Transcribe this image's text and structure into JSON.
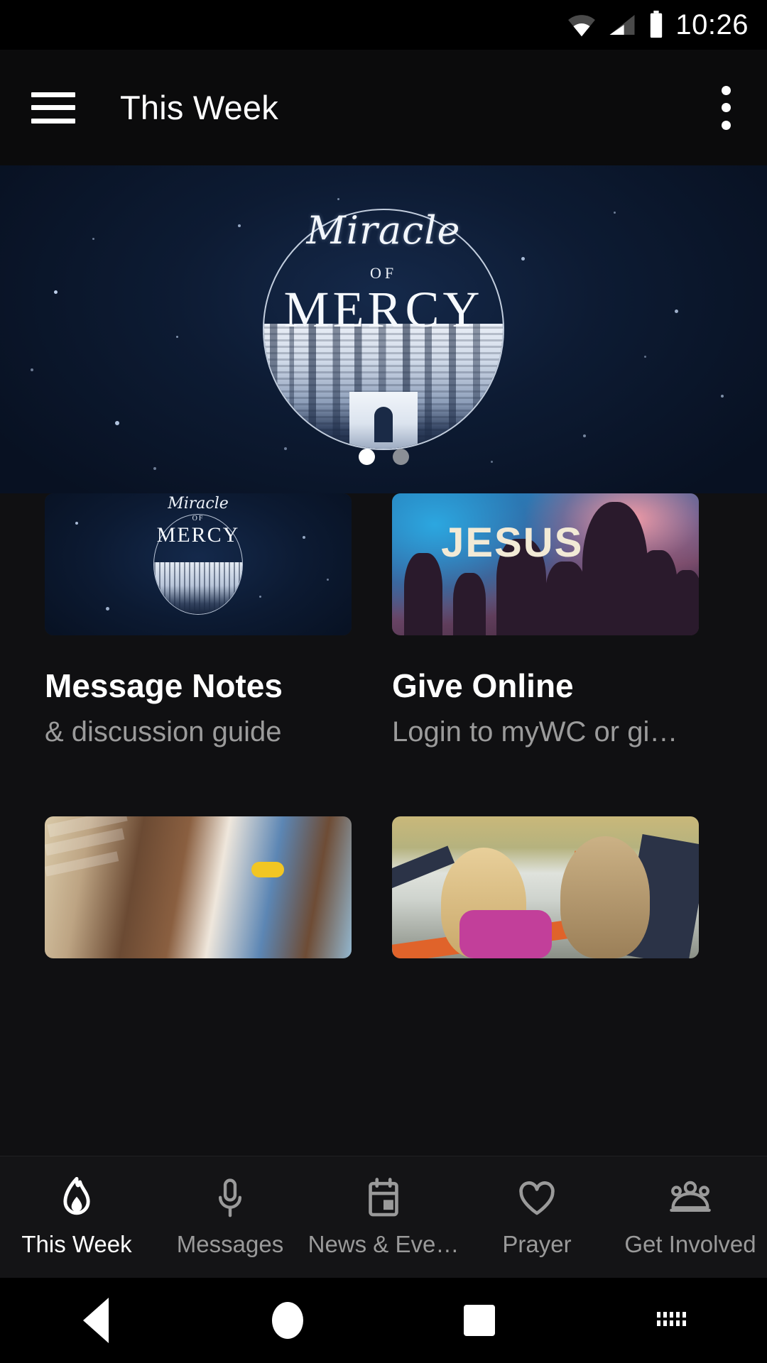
{
  "status_bar": {
    "time": "10:26",
    "icons": [
      "wifi-icon",
      "cellular-signal-icon",
      "battery-icon"
    ]
  },
  "app_bar": {
    "menu_icon": "hamburger-menu-icon",
    "title": "This Week",
    "overflow_icon": "overflow-menu-icon"
  },
  "hero": {
    "script_text": "Miracle",
    "of_text": "OF",
    "title_text": "MERCY",
    "carousel": {
      "total": 2,
      "active_index": 0
    }
  },
  "cards": [
    {
      "title": "Message Notes",
      "subtitle": "& discussion guide",
      "image_name": "miracle-of-mercy-thumbnail",
      "image_text": {
        "script": "Miracle",
        "of": "OF",
        "title": "MERCY"
      }
    },
    {
      "title": "Give Online",
      "subtitle": "Login to myWC or gi…",
      "image_name": "jesus-worship-thumbnail",
      "image_text": {
        "word": "JESUS"
      }
    },
    {
      "title": "",
      "subtitle": "",
      "image_name": "children-playing-thumbnail",
      "image_text": {}
    },
    {
      "title": "",
      "subtitle": "",
      "image_name": "girls-in-hammock-thumbnail",
      "image_text": {}
    }
  ],
  "bottom_nav": {
    "active_index": 0,
    "items": [
      {
        "label": "This Week",
        "icon": "flame-icon"
      },
      {
        "label": "Messages",
        "icon": "microphone-icon"
      },
      {
        "label": "News & Eve…",
        "icon": "calendar-icon"
      },
      {
        "label": "Prayer",
        "icon": "heart-icon"
      },
      {
        "label": "Get Involved",
        "icon": "people-group-icon"
      }
    ]
  },
  "android_nav": {
    "back": "back-triangle-icon",
    "home": "home-circle-icon",
    "recents": "recents-square-icon",
    "keyboard": "hide-keyboard-icon"
  },
  "colors": {
    "background": "#101012",
    "app_bar": "#0b0b0c",
    "tab_bar": "#141416",
    "active_text": "#ffffff",
    "inactive_text": "#9a9a9a",
    "hero_sky": "#0d1b33"
  }
}
